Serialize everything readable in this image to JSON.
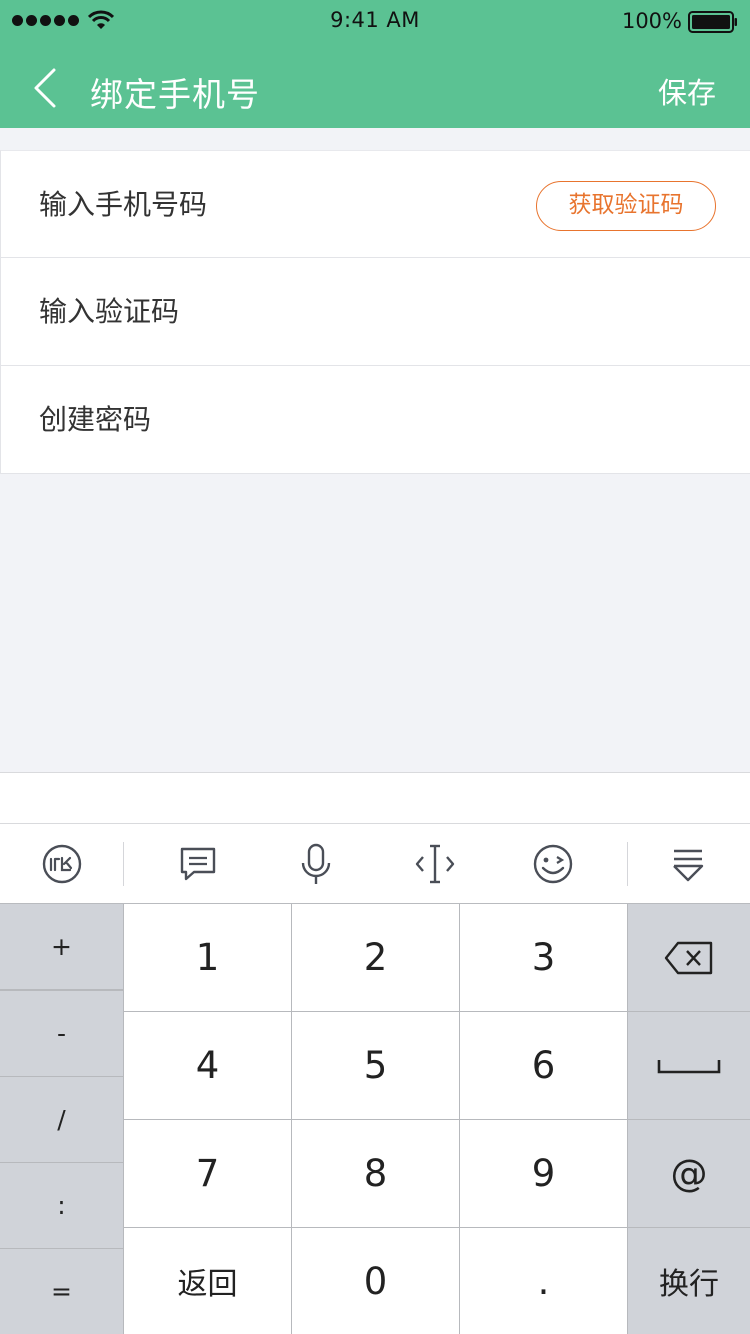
{
  "status_bar": {
    "time": "9:41 AM",
    "battery": "100%"
  },
  "nav": {
    "title": "绑定手机号",
    "save_label": "保存"
  },
  "form": {
    "phone_placeholder": "输入手机号码",
    "get_code_label": "获取验证码",
    "code_placeholder": "输入验证码",
    "password_placeholder": "创建密码"
  },
  "theme": {
    "accent": "#5bc293",
    "code_button": "#e8742e"
  },
  "keyboard": {
    "toolbar_icons": [
      "ime-logo-icon",
      "chat-bubble-icon",
      "microphone-icon",
      "cursor-move-icon",
      "emoji-icon",
      "hide-keyboard-icon"
    ],
    "symbols": [
      "+",
      "-",
      "/",
      ":",
      "="
    ],
    "rows": [
      [
        "1",
        "2",
        "3"
      ],
      [
        "4",
        "5",
        "6"
      ],
      [
        "7",
        "8",
        "9"
      ],
      [
        "返回",
        "0",
        "."
      ]
    ],
    "at_label": "@",
    "enter_label": "换行"
  }
}
